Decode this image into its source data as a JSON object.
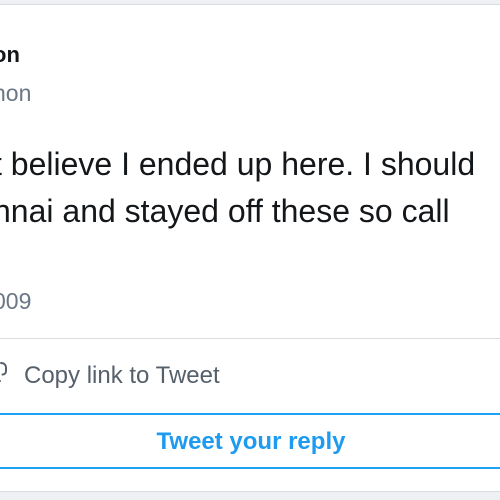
{
  "tweet": {
    "display_name": "on",
    "handle": "non",
    "text_lines": [
      "t believe I ended up here. I should",
      "nnai and stayed off these so call"
    ],
    "date": "009"
  },
  "actions": {
    "copy_link_label": "Copy link to Tweet",
    "copy_link_icon": "link-icon",
    "reply_label": "Tweet your reply"
  },
  "colors": {
    "accent": "#1da1f2",
    "text": "#14171a",
    "muted": "#6b7785",
    "divider": "#d9dde2"
  }
}
